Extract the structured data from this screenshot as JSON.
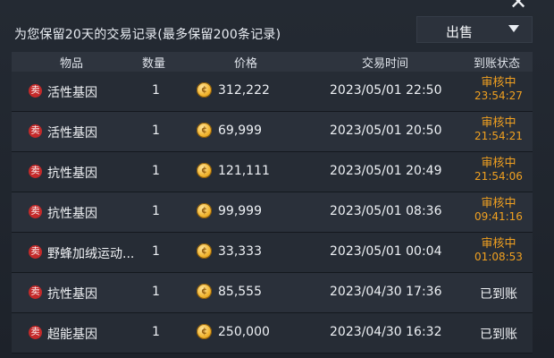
{
  "header": {
    "title": "为您保留20天的交易记录(最多保留200条记录)",
    "close_glyph": "✕",
    "type_select": {
      "value": "出售",
      "icon": "chevron-down-icon"
    }
  },
  "table": {
    "columns": [
      "物品",
      "数量",
      "价格",
      "交易时间",
      "到账状态"
    ],
    "sell_badge_text": "卖",
    "rows": [
      {
        "item": "活性基因",
        "qty": "1",
        "price": "312,222",
        "time": "2023/05/01  22:50",
        "status": "审核中",
        "countdown": "23:54:27"
      },
      {
        "item": "活性基因",
        "qty": "1",
        "price": "69,999",
        "time": "2023/05/01  20:50",
        "status": "审核中",
        "countdown": "21:54:21"
      },
      {
        "item": "抗性基因",
        "qty": "1",
        "price": "121,111",
        "time": "2023/05/01  20:49",
        "status": "审核中",
        "countdown": "21:54:06"
      },
      {
        "item": "抗性基因",
        "qty": "1",
        "price": "99,999",
        "time": "2023/05/01  08:36",
        "status": "审核中",
        "countdown": "09:41:16"
      },
      {
        "item": "野蜂加绒运动...",
        "qty": "1",
        "price": "33,333",
        "time": "2023/05/01  00:04",
        "status": "审核中",
        "countdown": "01:08:53"
      },
      {
        "item": "抗性基因",
        "qty": "1",
        "price": "85,555",
        "time": "2023/04/30  17:36",
        "status": "已到账",
        "countdown": ""
      },
      {
        "item": "超能基因",
        "qty": "1",
        "price": "250,000",
        "time": "2023/04/30  16:32",
        "status": "已到账",
        "countdown": ""
      }
    ]
  },
  "colors": {
    "pending": "#f0a020",
    "sell_badge": "#c42a2a",
    "coin": "#f2b52f"
  }
}
